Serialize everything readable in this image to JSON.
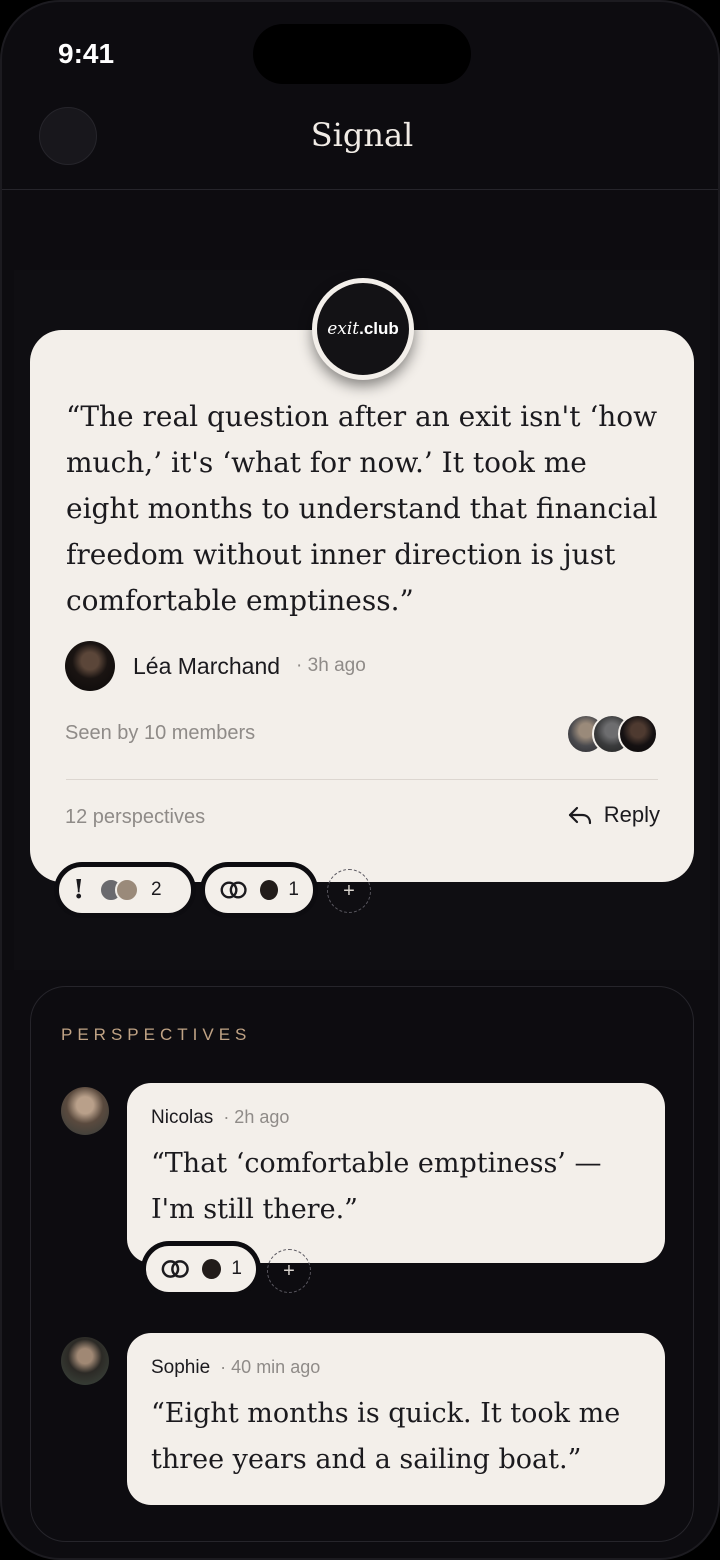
{
  "status_bar": {
    "time": "9:41"
  },
  "header": {
    "title": "Signal"
  },
  "post": {
    "club_badge": {
      "italic": "exit",
      "bold": ".club"
    },
    "quote": "“The real question after an exit isn't ‘how much,’ it's ‘what for now.’ It took me eight months to understand that financial freedom without inner direction is just comfortable emptiness.”",
    "author": {
      "name": "Léa Marchand",
      "time": "· 3h ago"
    },
    "seen_by": "Seen by 10 members",
    "perspectives_count": "12 perspectives",
    "reply_label": "Reply",
    "reactions": [
      {
        "icon": "exclamation-icon",
        "glyph": "!",
        "count": "2"
      },
      {
        "icon": "interlocking-rings-icon",
        "glyph": "",
        "count": "1"
      }
    ],
    "add_reaction_label": "+"
  },
  "perspectives": {
    "label": "PERSPECTIVES",
    "comments": [
      {
        "name": "Nicolas",
        "time": "· 2h ago",
        "text": "“That ‘comfortable emptiness’ — I'm still there.”",
        "reaction_count": "1",
        "add_reaction_label": "+"
      },
      {
        "name": "Sophie",
        "time": "· 40 min ago",
        "text": "“Eight months is quick. It took me three years and a sailing boat.”"
      }
    ]
  },
  "colors": {
    "background": "#0d0c10",
    "card": "#f3efea",
    "accent_label": "#c0a385",
    "muted_text": "#8f8b88"
  }
}
